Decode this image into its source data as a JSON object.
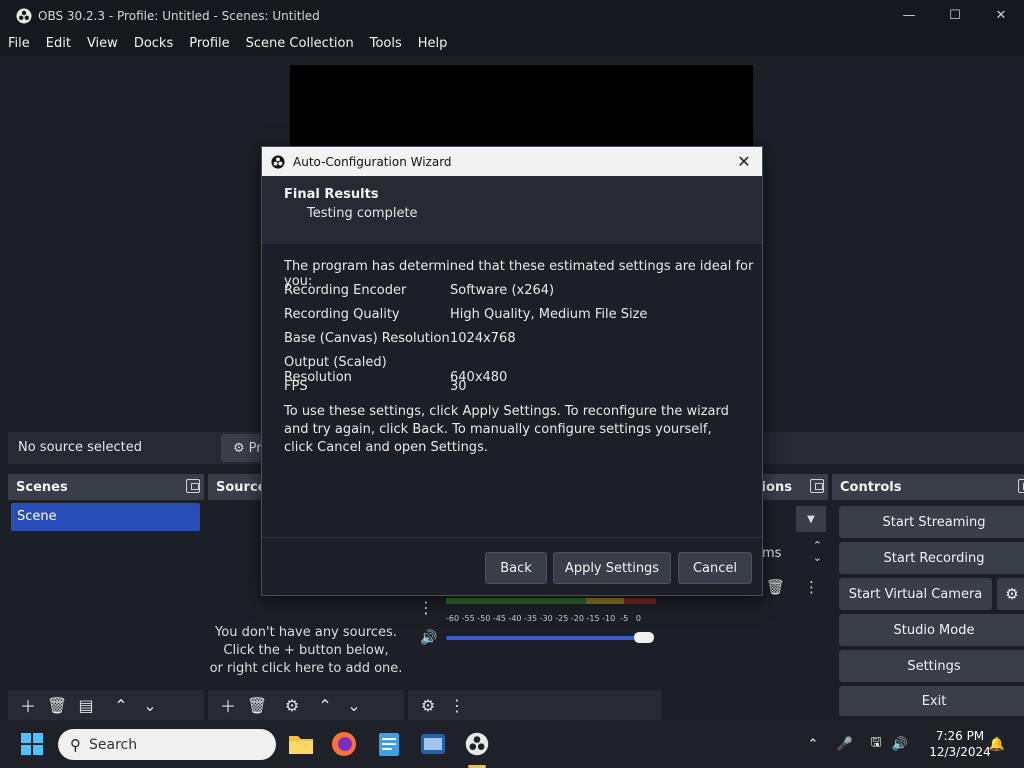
{
  "window": {
    "title": "OBS 30.2.3 - Profile: Untitled - Scenes: Untitled"
  },
  "menu": [
    "File",
    "Edit",
    "View",
    "Docks",
    "Profile",
    "Scene Collection",
    "Tools",
    "Help"
  ],
  "source_bar": {
    "no_source": "No source selected",
    "properties_label": "Pr"
  },
  "scenes": {
    "title": "Scenes",
    "items": [
      "Scene"
    ]
  },
  "sources": {
    "title": "Source",
    "empty_lines": [
      "You don't have any sources.",
      "Click the + button below,",
      "or right click here to add one."
    ]
  },
  "mixer": {
    "scale": "-60 -55 -50 -45 -40 -35 -30 -25 -20 -15 -10  -5   0",
    "volume_level": 1.0
  },
  "transitions": {
    "title_fragment": "tions",
    "duration_fragment": "ms"
  },
  "controls": {
    "title": "Controls",
    "start_streaming": "Start Streaming",
    "start_recording": "Start Recording",
    "start_virtual_camera": "Start Virtual Camera",
    "studio_mode": "Studio Mode",
    "settings": "Settings",
    "exit": "Exit"
  },
  "dialog": {
    "title": "Auto-Configuration Wizard",
    "header": "Final Results",
    "subheader": "Testing complete",
    "intro": "The program has determined that these estimated settings are ideal for you:",
    "rows": [
      {
        "key": "Recording Encoder",
        "value": "Software (x264)"
      },
      {
        "key": "Recording Quality",
        "value": "High Quality, Medium File Size"
      },
      {
        "key": "Base (Canvas) Resolution",
        "value": "1024x768"
      },
      {
        "key": "Output (Scaled) Resolution",
        "value": "640x480"
      },
      {
        "key": "FPS",
        "value": "30"
      }
    ],
    "note": "To use these settings, click Apply Settings. To reconfigure the wizard and try again, click Back. To manually configure settings yourself, click Cancel and open Settings.",
    "back": "Back",
    "apply": "Apply Settings",
    "cancel": "Cancel"
  },
  "taskbar": {
    "search_placeholder": "Search",
    "time": "7:26 PM",
    "date": "12/3/2024"
  }
}
